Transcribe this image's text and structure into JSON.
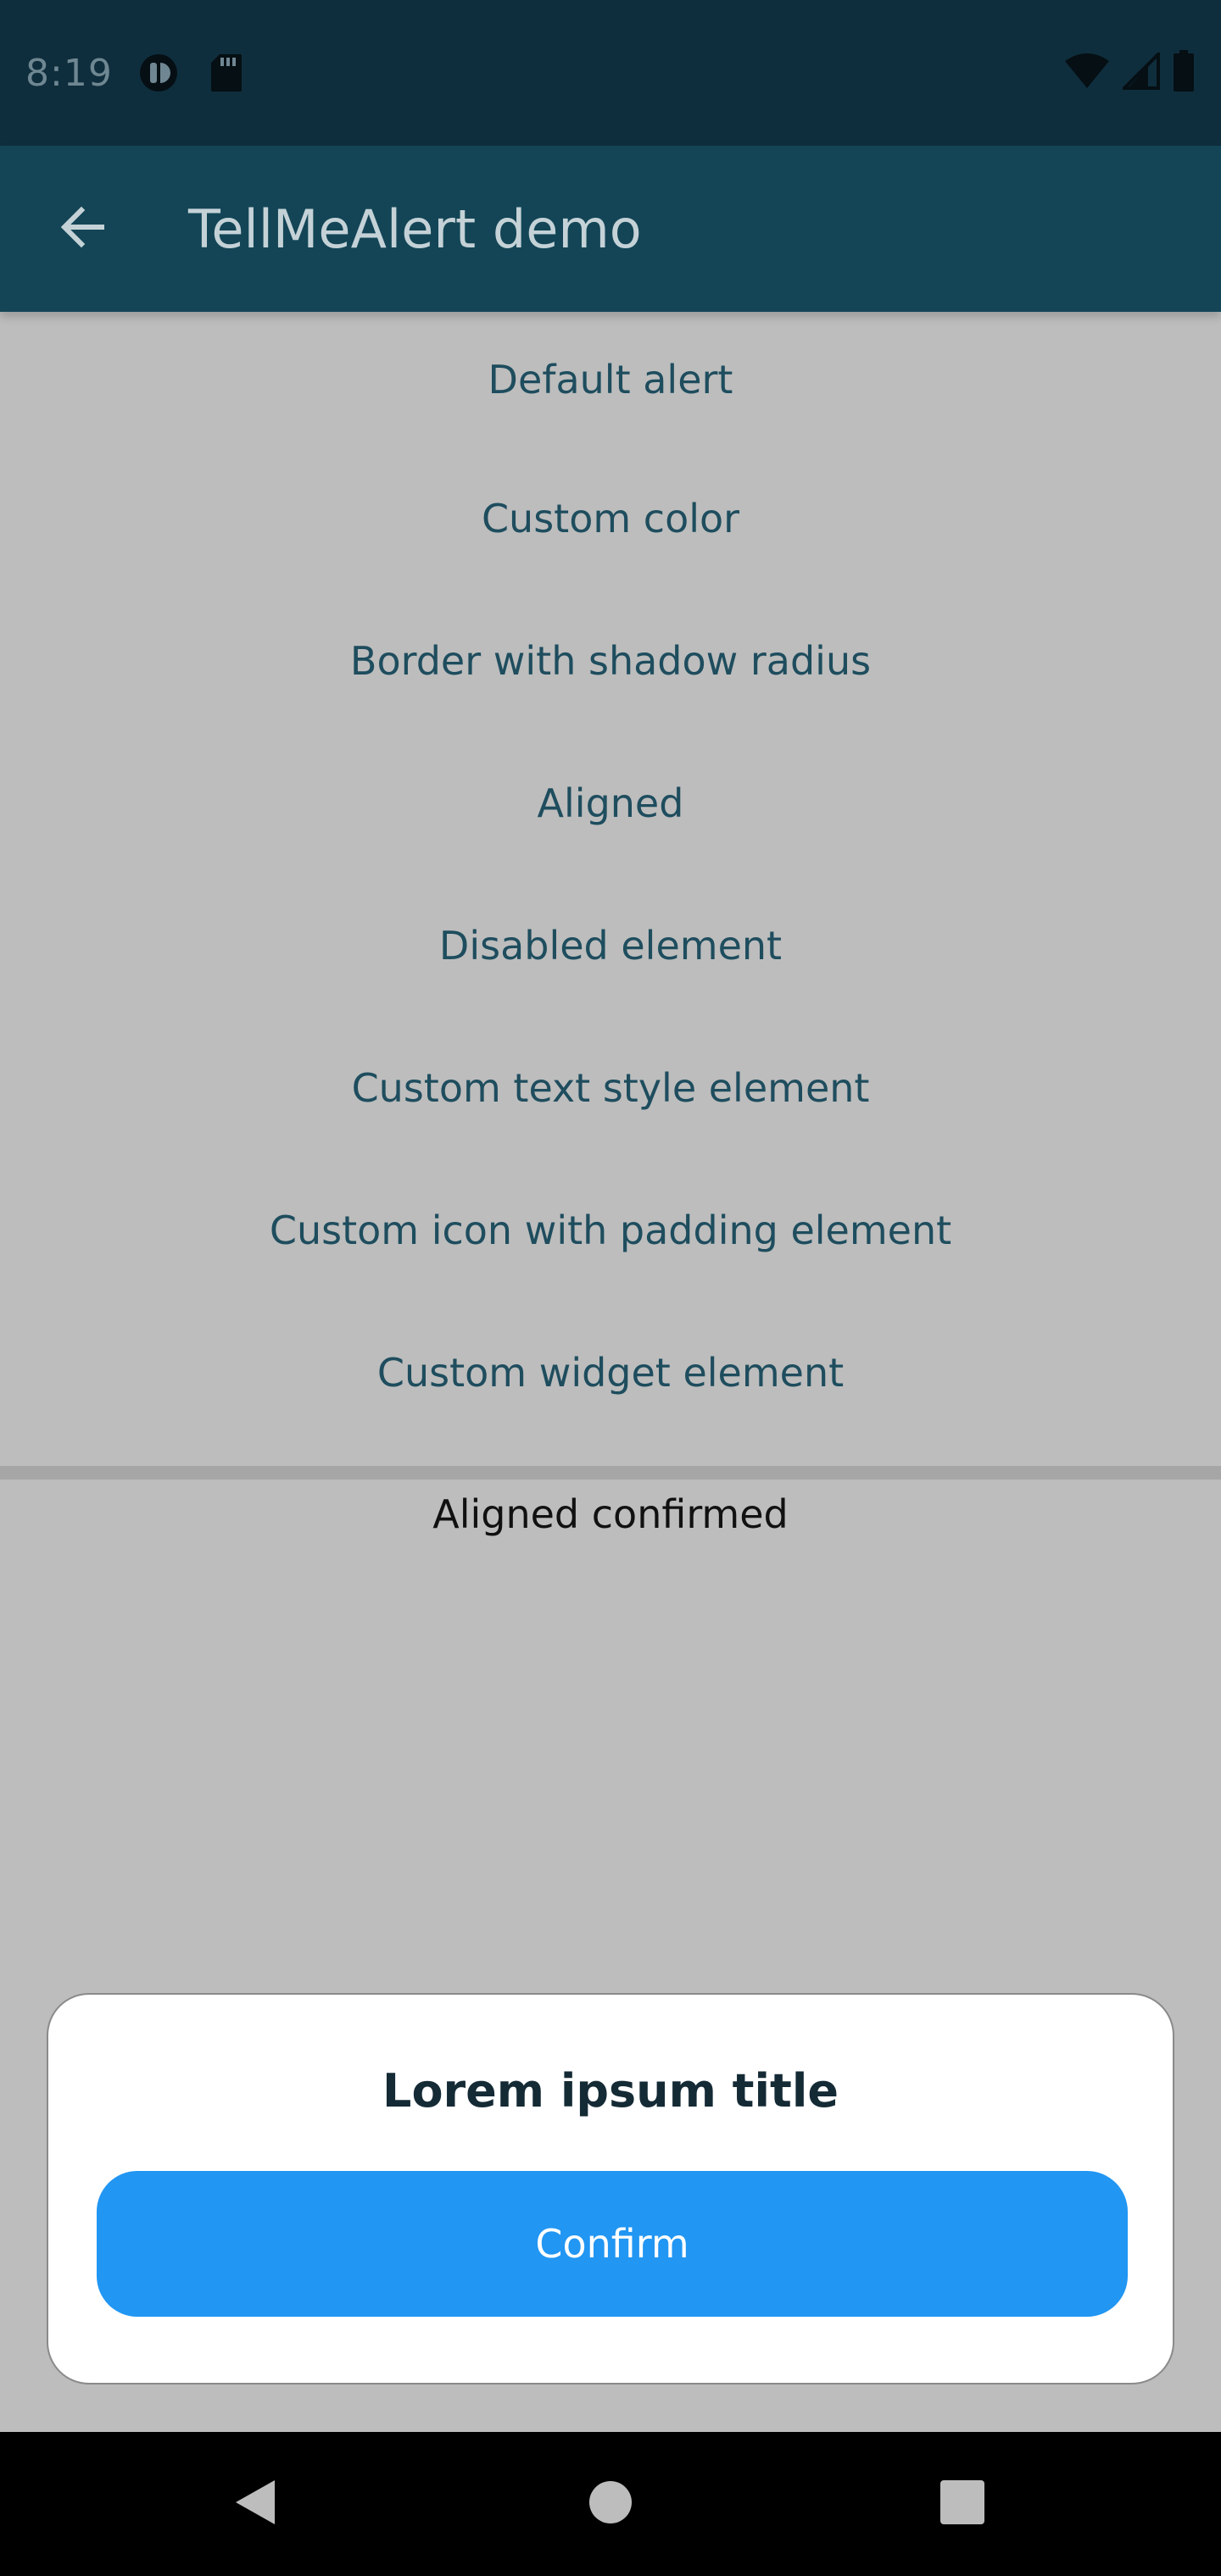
{
  "status_bar": {
    "time": "8:19",
    "left_icons": [
      "record-icon",
      "sd-card-icon"
    ],
    "right_icons": [
      "wifi-icon",
      "cell-signal-icon",
      "battery-icon"
    ]
  },
  "app_bar": {
    "title": "TellMeAlert demo",
    "back_icon": "arrow-back-icon"
  },
  "menu": {
    "items": [
      {
        "label": "Default alert"
      },
      {
        "label": "Custom color"
      },
      {
        "label": "Border with shadow radius"
      },
      {
        "label": "Aligned"
      },
      {
        "label": "Disabled element"
      },
      {
        "label": "Custom text style element"
      },
      {
        "label": "Custom icon with padding element"
      },
      {
        "label": "Custom widget element"
      }
    ]
  },
  "result": {
    "text": "Aligned confirmed"
  },
  "alert": {
    "title": "Lorem ipsum title",
    "button_label": "Confirm",
    "button_color": "#2196f3"
  },
  "nav_bar": {
    "icons": [
      "nav-back-icon",
      "nav-home-icon",
      "nav-recents-icon"
    ]
  },
  "colors": {
    "status_bar": "#0f2e3d",
    "app_bar": "#134556",
    "background": "#bdbdbd",
    "menu_text": "#1e4d5e"
  }
}
